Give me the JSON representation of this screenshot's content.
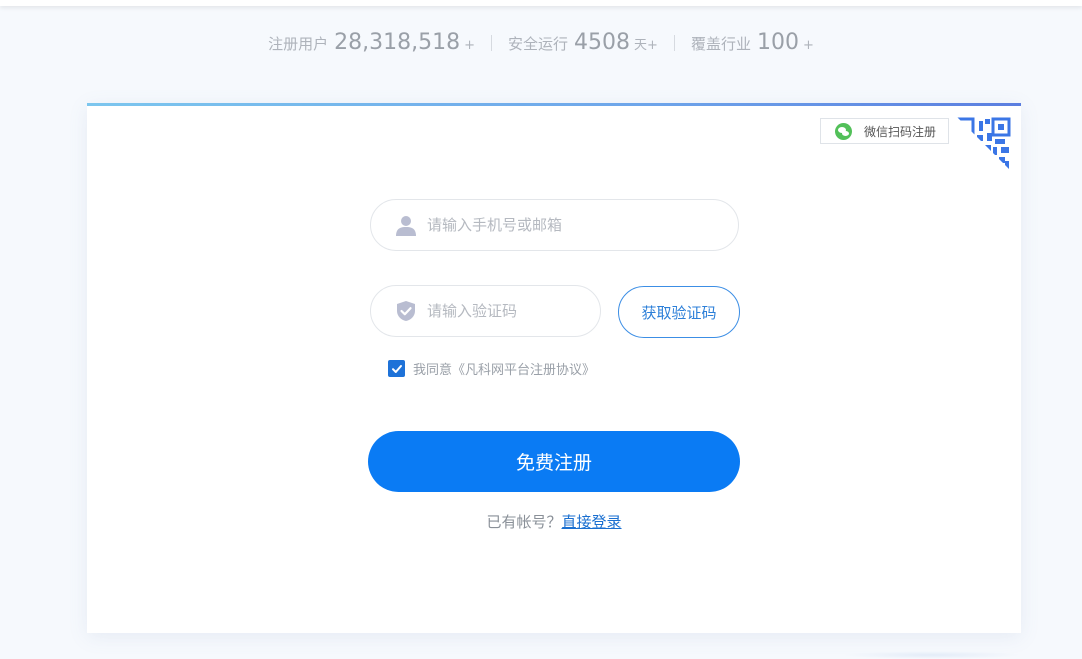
{
  "stats": [
    {
      "label": "注册用户",
      "value": "28,318,518",
      "unit": "+"
    },
    {
      "label": "安全运行",
      "value": "4508",
      "unit": "天+"
    },
    {
      "label": "覆盖行业",
      "value": "100",
      "unit": "+"
    }
  ],
  "wechat": {
    "label": "微信扫码注册"
  },
  "form": {
    "account_placeholder": "请输入手机号或邮箱",
    "code_placeholder": "请输入验证码",
    "get_code_label": "获取验证码",
    "agree_text": "我同意《凡科网平台注册协议》",
    "agree_checked": true,
    "register_label": "免费注册",
    "login_prompt": "已有帐号？",
    "login_link": "直接登录"
  },
  "colors": {
    "primary": "#0a7bf4",
    "link": "#1a6fd0",
    "wechat_green": "#52c059"
  }
}
